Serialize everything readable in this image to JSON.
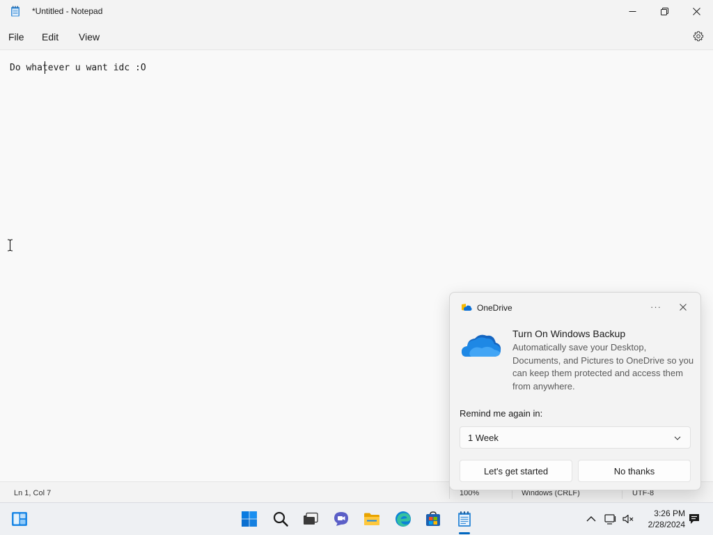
{
  "window": {
    "title": "*Untitled - Notepad"
  },
  "menu": {
    "file": "File",
    "edit": "Edit",
    "view": "View"
  },
  "editor": {
    "text": "Do whatever u want idc :O"
  },
  "status": {
    "position": "Ln 1, Col 7",
    "zoom": "100%",
    "line_ending": "Windows (CRLF)",
    "encoding": "UTF-8"
  },
  "toast": {
    "app_name": "OneDrive",
    "more": "···",
    "heading": "Turn On Windows Backup",
    "body": "Automatically save your Desktop, Documents, and Pictures to OneDrive so you can keep them protected and access them from anywhere.",
    "remind_label": "Remind me again in:",
    "remind_value": "1 Week",
    "primary_button": "Let's get started",
    "secondary_button": "No thanks"
  },
  "taskbar": {
    "time": "3:26 PM",
    "date": "2/28/2024",
    "icons": [
      "widgets-icon",
      "start-icon",
      "search-icon",
      "task-view-icon",
      "teams-chat-icon",
      "file-explorer-icon",
      "edge-icon",
      "store-icon",
      "notepad-icon"
    ]
  },
  "colors": {
    "accent": "#0067c0",
    "onedrive_blue": "#1e88e5",
    "toast_bg": "#f3f3f3"
  }
}
